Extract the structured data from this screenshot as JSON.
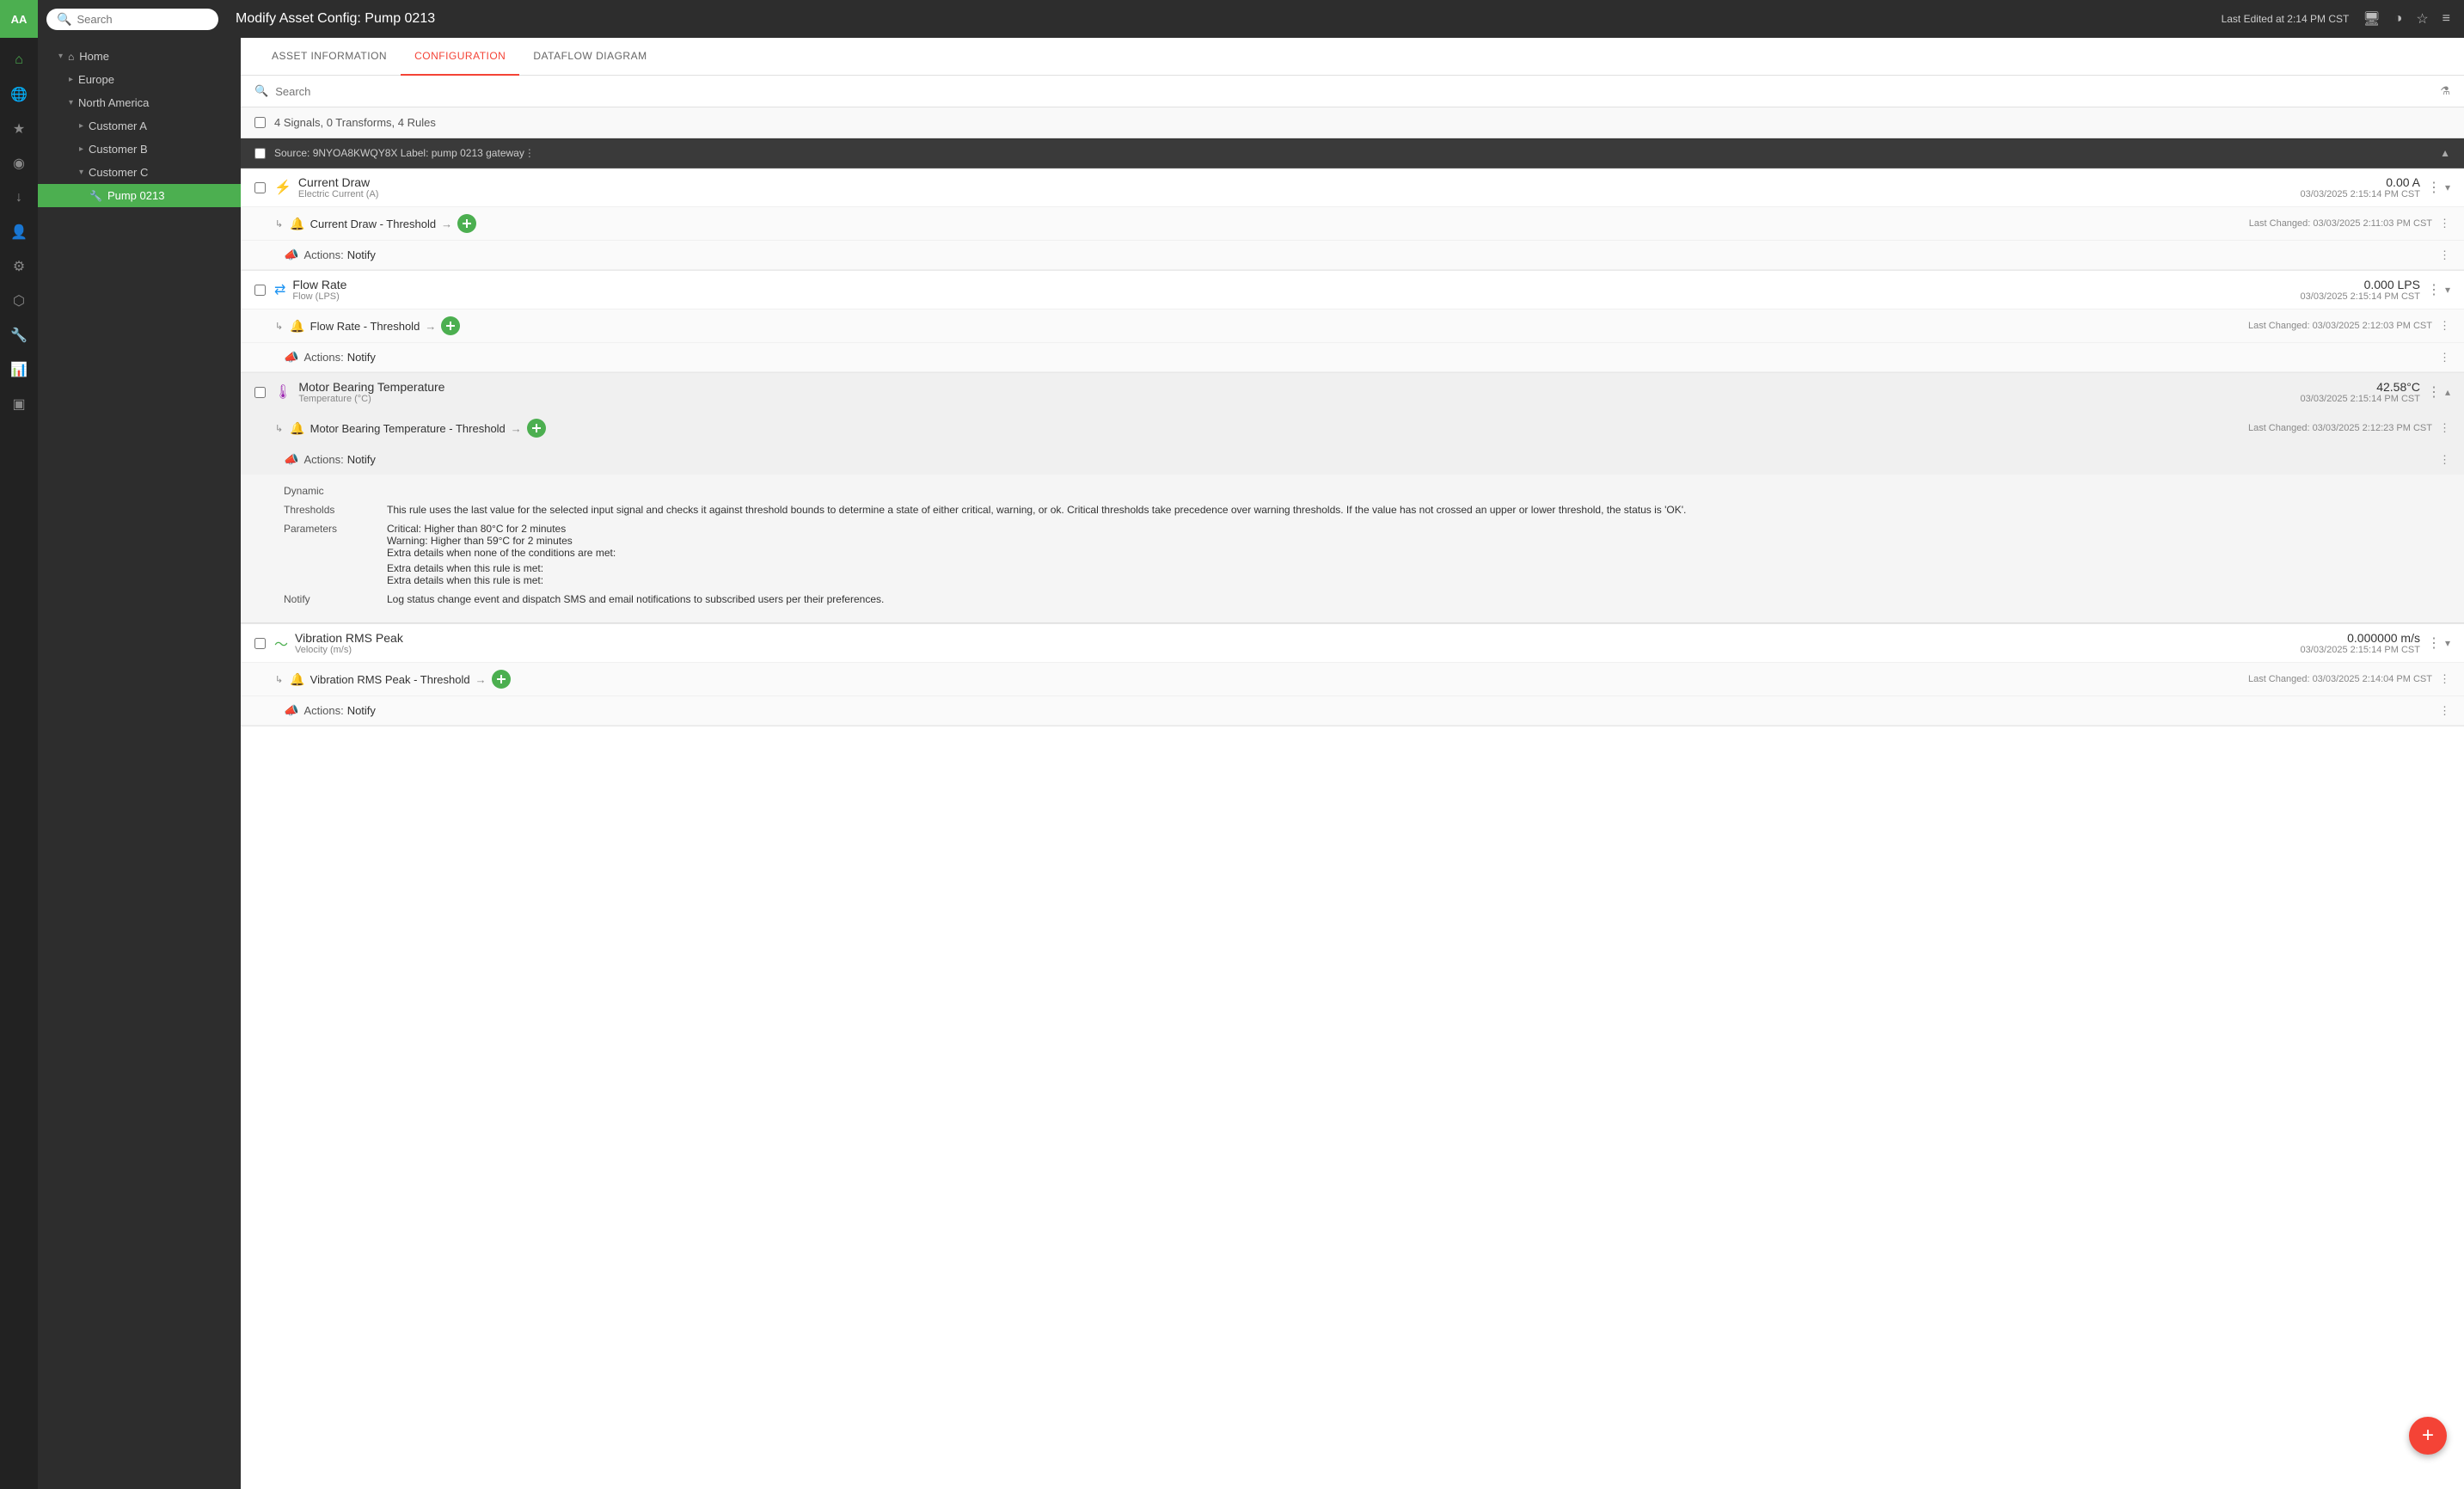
{
  "topbar": {
    "logo": "AA",
    "search_placeholder": "Search",
    "title": "Modify Asset Config: Pump 0213",
    "last_edited": "Last Edited at 2:14 PM CST"
  },
  "sidebar": {
    "nav_items": [
      {
        "id": "home",
        "label": "Home",
        "indent": 0,
        "arrow": "▾",
        "type": "folder"
      },
      {
        "id": "europe",
        "label": "Europe",
        "indent": 1,
        "arrow": "▸",
        "type": "folder"
      },
      {
        "id": "north-america",
        "label": "North America",
        "indent": 1,
        "arrow": "▾",
        "type": "folder"
      },
      {
        "id": "customer-a",
        "label": "Customer A",
        "indent": 2,
        "arrow": "▸",
        "type": "folder"
      },
      {
        "id": "customer-b",
        "label": "Customer B",
        "indent": 2,
        "arrow": "▸",
        "type": "folder"
      },
      {
        "id": "customer-c",
        "label": "Customer C",
        "indent": 2,
        "arrow": "▾",
        "type": "folder"
      },
      {
        "id": "pump-0213",
        "label": "Pump 0213",
        "indent": 3,
        "arrow": "",
        "type": "asset",
        "active": true
      }
    ]
  },
  "tabs": [
    {
      "id": "asset-information",
      "label": "ASSET INFORMATION",
      "active": false
    },
    {
      "id": "configuration",
      "label": "CONFIGURATION",
      "active": true
    },
    {
      "id": "dataflow-diagram",
      "label": "DATAFLOW DIAGRAM",
      "active": false
    }
  ],
  "config": {
    "search_placeholder": "Search",
    "summary": "4 Signals, 0 Transforms, 4 Rules",
    "source": {
      "label": "Source: 9NYOA8KWQY8X  Label: pump 0213 gateway"
    },
    "signals": [
      {
        "id": "current-draw",
        "name": "Current Draw",
        "type": "Electric Current (A)",
        "value": "0.00 A",
        "date": "03/03/2025 2:15:14 PM CST",
        "expanded": false,
        "rules": [
          {
            "name": "Current Draw - Threshold",
            "last_changed": "Last Changed: 03/03/2025 2:11:03 PM CST",
            "actions": [
              {
                "label": "Actions:",
                "value": "Notify"
              }
            ]
          }
        ]
      },
      {
        "id": "flow-rate",
        "name": "Flow Rate",
        "type": "Flow (LPS)",
        "value": "0.000 LPS",
        "date": "03/03/2025 2:15:14 PM CST",
        "expanded": false,
        "rules": [
          {
            "name": "Flow Rate - Threshold",
            "last_changed": "Last Changed: 03/03/2025 2:12:03 PM CST",
            "actions": [
              {
                "label": "Actions:",
                "value": "Notify"
              }
            ]
          }
        ]
      },
      {
        "id": "motor-bearing-temperature",
        "name": "Motor Bearing Temperature",
        "type": "Temperature (°C)",
        "value": "42.58°C",
        "date": "03/03/2025 2:15:14 PM CST",
        "expanded": true,
        "rules": [
          {
            "name": "Motor Bearing Temperature - Threshold",
            "last_changed": "Last Changed: 03/03/2025 2:12:23 PM CST",
            "actions": [
              {
                "label": "Actions:",
                "value": "Notify"
              }
            ],
            "detail": {
              "type_label": "Dynamic",
              "thresholds_label": "Thresholds",
              "thresholds_value": "This rule uses the last value for the selected input signal and checks it against threshold bounds to determine a state of either critical, warning, or ok. Critical thresholds take precedence over warning thresholds. If the value has not crossed an upper or lower threshold, the status is 'OK'.",
              "parameters_label": "Parameters",
              "parameters_critical": "Critical: Higher than 80°C for 2 minutes",
              "parameters_warning": "Warning: Higher than 59°C for 2 minutes",
              "parameters_extra1": "Extra details when none of the conditions are met:",
              "parameters_extra2": "Extra details when this rule is met:",
              "parameters_extra3": "Extra details when this rule is met:",
              "notify_label": "Notify",
              "notify_value": "Log status change event and dispatch SMS and email notifications to subscribed users per their preferences."
            }
          }
        ]
      },
      {
        "id": "vibration-rms-peak",
        "name": "Vibration RMS Peak",
        "type": "Velocity (m/s)",
        "value": "0.000000 m/s",
        "date": "03/03/2025 2:15:14 PM CST",
        "expanded": false,
        "rules": [
          {
            "name": "Vibration RMS Peak - Threshold",
            "last_changed": "Last Changed: 03/03/2025 2:14:04 PM CST",
            "actions": [
              {
                "label": "Actions:",
                "value": "Notify"
              }
            ]
          }
        ]
      }
    ]
  }
}
